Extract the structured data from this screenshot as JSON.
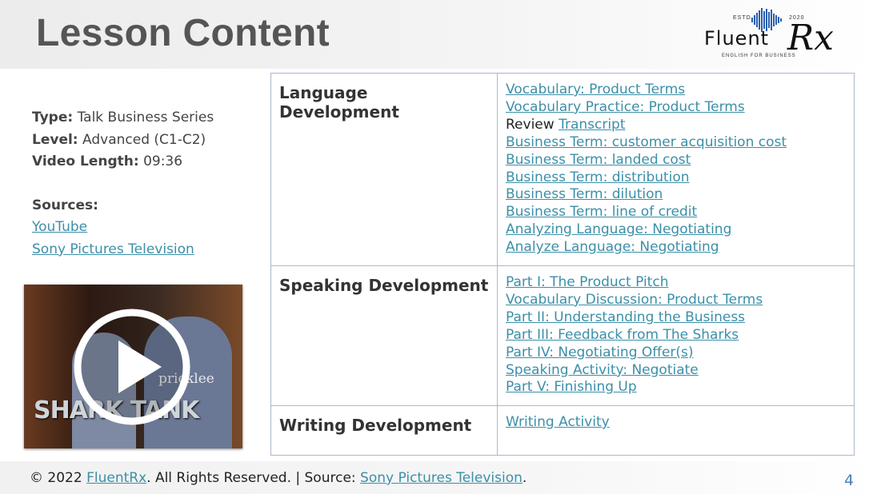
{
  "header": {
    "title": "Lesson Content",
    "logo": {
      "wordmark": "Fluent",
      "rx": "Rx",
      "est": "ESTD",
      "year": "2020",
      "tagline": "ENGLISH FOR BUSINESS"
    }
  },
  "meta": {
    "type_label": "Type:",
    "type_value": "Talk Business Series",
    "level_label": "Level:",
    "level_value": "Advanced (C1-C2)",
    "length_label": "Video Length:",
    "length_value": "09:36",
    "sources_label": "Sources:",
    "sources": [
      "YouTube",
      "Sony Pictures Television"
    ]
  },
  "video": {
    "overlay_text": "SHARK TANK",
    "shirt_text": "pricklee"
  },
  "table": {
    "rows": [
      {
        "category": "Language Development",
        "review_prefix": "Review",
        "items": [
          "Vocabulary: Product Terms",
          "Vocabulary Practice: Product Terms",
          "Transcript",
          "Business Term: customer acquisition cost",
          "Business Term: landed cost",
          "Business Term: distribution",
          "Business Term: dilution",
          "Business Term: line of credit",
          "Analyzing Language: Negotiating",
          "Analyze Language: Negotiating"
        ]
      },
      {
        "category": "Speaking Development",
        "items": [
          "Part I: The Product Pitch",
          "Vocabulary Discussion: Product Terms",
          "Part II: Understanding the Business",
          "Part III: Feedback from The Sharks",
          "Part IV: Negotiating Offer(s)",
          "Speaking Activity: Negotiate",
          "Part V: Finishing Up"
        ]
      },
      {
        "category": "Writing Development",
        "items": [
          "Writing Activity"
        ]
      }
    ]
  },
  "footer": {
    "copyright_prefix": "© 2022",
    "brand_link": "FluentRx",
    "middle_text": ". All Rights Reserved. | Source:",
    "source_link": "Sony Pictures Television",
    "suffix": ".",
    "page_number": "4"
  },
  "colors": {
    "link": "#3c8fa8",
    "border": "#aab8cf",
    "title": "#555555",
    "page_number": "#4a7fc0"
  }
}
